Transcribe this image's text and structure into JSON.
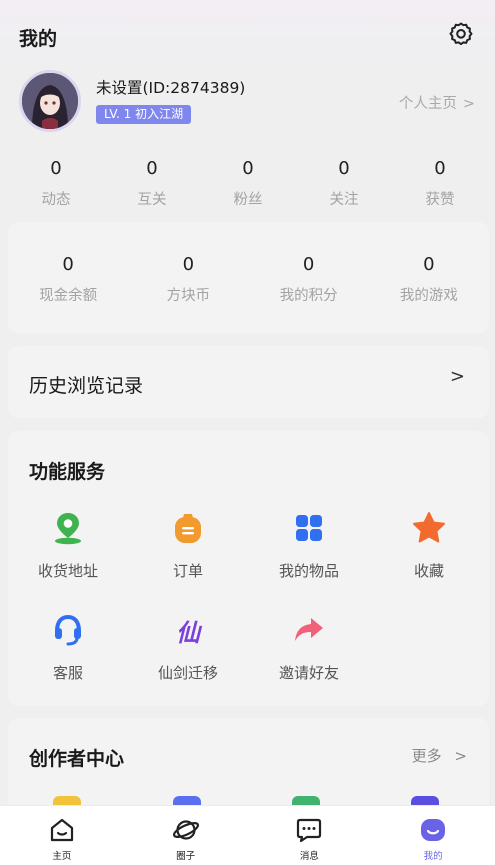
{
  "header": {
    "title": "我的",
    "settings_icon": "gear-icon"
  },
  "profile": {
    "name": "未设置(ID:2874389)",
    "level_badge": "LV. 1 初入江湖",
    "homepage_link": "个人主页",
    "chevron": ">"
  },
  "stats": [
    {
      "value": "0",
      "label": "动态"
    },
    {
      "value": "0",
      "label": "互关"
    },
    {
      "value": "0",
      "label": "粉丝"
    },
    {
      "value": "0",
      "label": "关注"
    },
    {
      "value": "0",
      "label": "获赞"
    }
  ],
  "wallet": [
    {
      "value": "0",
      "label": "现金余额"
    },
    {
      "value": "0",
      "label": "方块币"
    },
    {
      "value": "0",
      "label": "我的积分"
    },
    {
      "value": "0",
      "label": "我的游戏"
    }
  ],
  "history": {
    "label": "历史浏览记录",
    "chevron": ">"
  },
  "services": {
    "title": "功能服务",
    "items": [
      {
        "label": "收货地址",
        "icon": "location-pin-icon",
        "color": "#3fb34f"
      },
      {
        "label": "订单",
        "icon": "order-bag-icon",
        "color": "#f29a2e"
      },
      {
        "label": "我的物品",
        "icon": "grid-icon",
        "color": "#2f6ff0"
      },
      {
        "label": "收藏",
        "icon": "star-icon",
        "color": "#f26a2e"
      },
      {
        "label": "客服",
        "icon": "headset-icon",
        "color": "#2f6ff0"
      },
      {
        "label": "仙剑迁移",
        "icon": "xian-glyph-icon",
        "glyph": "仙",
        "color": "#7b3fe0"
      },
      {
        "label": "邀请好友",
        "icon": "share-arrow-icon",
        "color": "#f2617a"
      }
    ]
  },
  "creator": {
    "title": "创作者中心",
    "more": "更多",
    "chevron": ">"
  },
  "tabbar": [
    {
      "label": "主页",
      "icon": "home-icon",
      "active": false
    },
    {
      "label": "圈子",
      "icon": "planet-icon",
      "active": false
    },
    {
      "label": "消息",
      "icon": "message-icon",
      "active": false
    },
    {
      "label": "我的",
      "icon": "profile-face-icon",
      "active": true
    }
  ],
  "colors": {
    "accent": "#6a63e8",
    "badge": "#7f86ee",
    "muted_text": "#a3a3a3"
  }
}
